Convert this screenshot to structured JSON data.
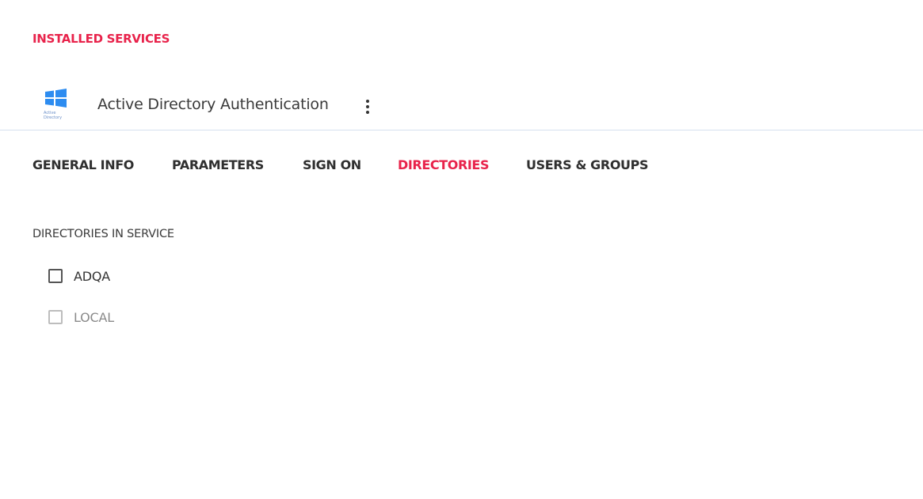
{
  "colors": {
    "accent": "#e8234b",
    "text": "#333333",
    "divider": "#d6e1ef",
    "logo_blue": "#2d8cf0"
  },
  "page": {
    "section_title": "INSTALLED SERVICES"
  },
  "service": {
    "icon": "windows-active-directory-icon",
    "logo_caption": "Active Directory",
    "name": "Active Directory Authentication",
    "menu_icon": "more-vertical-icon"
  },
  "tabs": [
    {
      "label": "GENERAL INFO",
      "active": false
    },
    {
      "label": "PARAMETERS",
      "active": false
    },
    {
      "label": "SIGN ON",
      "active": false
    },
    {
      "label": "DIRECTORIES",
      "active": true
    },
    {
      "label": "USERS & GROUPS",
      "active": false
    }
  ],
  "directories": {
    "label": "DIRECTORIES IN SERVICE",
    "items": [
      {
        "name": "ADQA",
        "checked": false,
        "disabled": false
      },
      {
        "name": "LOCAL",
        "checked": false,
        "disabled": true
      }
    ]
  }
}
